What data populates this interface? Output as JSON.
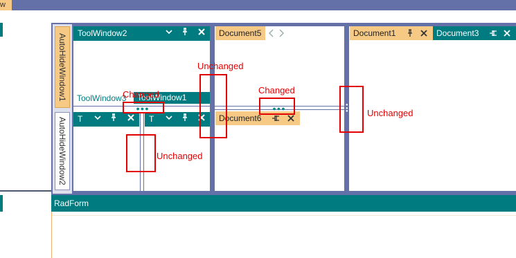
{
  "app": {
    "title_fragment": "w",
    "form_title": "RadForm"
  },
  "autohide": {
    "tab1": "AutoHideWindow1",
    "tab2": "AutoHideWindow2"
  },
  "toolwindow2": {
    "title": "ToolWindow2"
  },
  "tabstrip_overlap": {
    "tab_a": "ToolWindow3",
    "tab_b": "ToolWindow1"
  },
  "bottom_tools": {
    "left_title": "T",
    "right_title": "T"
  },
  "documents": {
    "doc5": "Document5",
    "doc6": "Document6",
    "doc1": "Document1",
    "doc3": "Document3"
  },
  "annotations": {
    "changed_1": "Changed",
    "changed_2": "Changed",
    "unchanged_1": "Unchanged",
    "unchanged_2": "Unchanged",
    "unchanged_3": "Unchanged"
  },
  "icons": {
    "dropdown": "chevron-down-icon",
    "pin": "pin-icon",
    "close": "close-icon",
    "unpin": "unpin-icon",
    "nav_left": "chevron-left-icon",
    "nav_right": "chevron-right-icon",
    "grip": "splitter-grip-icon"
  },
  "colors": {
    "accent": "#007c80",
    "frame": "#6470a8",
    "doc_tab": "#f6c985",
    "annotation": "#e30000"
  }
}
